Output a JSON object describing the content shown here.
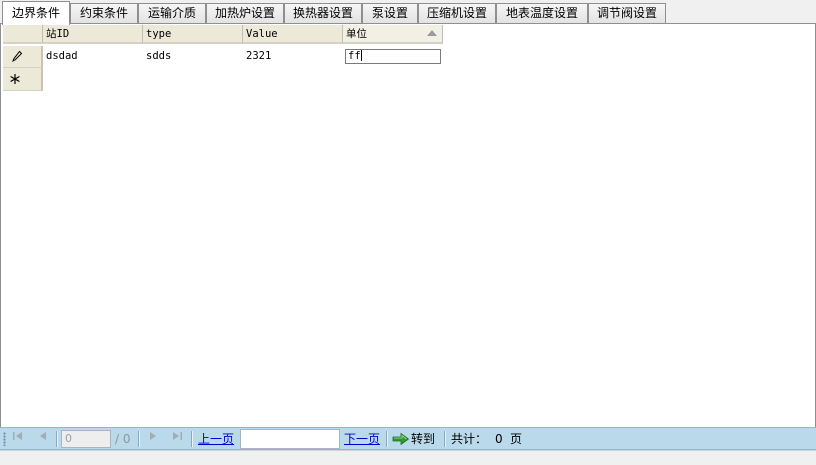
{
  "tabs": [
    {
      "label": "边界条件",
      "active": true
    },
    {
      "label": "约束条件"
    },
    {
      "label": "运输介质"
    },
    {
      "label": "加热炉设置"
    },
    {
      "label": "换热器设置"
    },
    {
      "label": "泵设置"
    },
    {
      "label": "压缩机设置"
    },
    {
      "label": "地表温度设置"
    },
    {
      "label": "调节阀设置"
    }
  ],
  "grid": {
    "columns": [
      "站ID",
      "type",
      "Value",
      "单位"
    ],
    "rows": [
      {
        "cells": [
          "dsdad",
          "sdds",
          "2321",
          "ff"
        ],
        "editing_column": 3
      }
    ],
    "row_indicators": {
      "edit_icon": "pencil-icon",
      "new_row_icon": "asterisk-icon"
    }
  },
  "pager": {
    "current_page": "0",
    "total_pages_text": "/ 0",
    "prev_label": "上一页",
    "next_label": "下一页",
    "goto_value": "",
    "goto_label": "转到",
    "total_label": "共计：",
    "total_count": "0",
    "page_unit": "页"
  },
  "colors": {
    "toolbar_bg": "#bad9ea",
    "header_bg": "#ece9d8",
    "link": "#0000cc",
    "goto_arrow": "#2e9b2e"
  }
}
